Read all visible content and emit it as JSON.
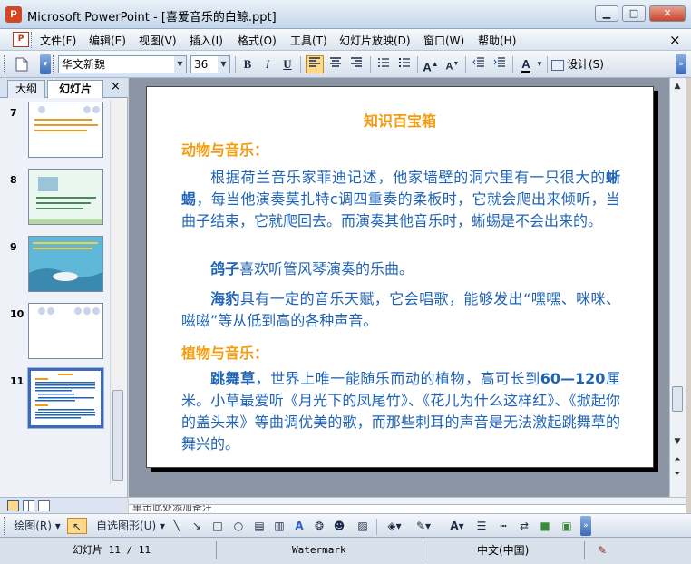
{
  "window": {
    "title": "Microsoft PowerPoint - [喜爱音乐的白鲸.ppt]",
    "app_icon_letter": "P",
    "minimize": "▁",
    "maximize": "□",
    "close": "✕"
  },
  "menu": {
    "items": [
      "文件(F)",
      "编辑(E)",
      "视图(V)",
      "插入(I)",
      "格式(O)",
      "工具(T)",
      "幻灯片放映(D)",
      "窗口(W)",
      "帮助(H)"
    ],
    "close": "×"
  },
  "toolbar": {
    "font_name": "华文新魏",
    "font_size": "36",
    "bold": "B",
    "italic": "I",
    "underline": "U",
    "design": "设计(S)",
    "more": "»"
  },
  "panel": {
    "tabs": [
      "大纲",
      "幻灯片"
    ],
    "close": "×",
    "thumbnails": [
      {
        "number": "7"
      },
      {
        "number": "8"
      },
      {
        "number": "9"
      },
      {
        "number": "10"
      },
      {
        "number": "11",
        "selected": true
      }
    ]
  },
  "slide": {
    "title": "知识百宝箱",
    "section_animals": "动物与音乐：",
    "p1_pre": "根据荷兰音乐家菲迪记述，他家墙壁的洞穴里有一只很大的",
    "p1_bold": "蜥蜴",
    "p1_post": "，每当他演奏莫扎特c调四重奏的柔板时，它就会爬出来倾听，当曲子结束，它就爬回去。而演奏其他音乐时，蜥蜴是不会出来的。",
    "p2_bold": "鸽子",
    "p2_post": "喜欢听管风琴演奏的乐曲。",
    "p3_bold": "海豹",
    "p3_post": "具有一定的音乐天赋，它会唱歌，能够发出“嘿嘿、咪咪、嗞嗞”等从低到高的各种声音。",
    "section_plants": "植物与音乐：",
    "p4_bold": "跳舞草",
    "p4_mid": "，世界上唯一能随乐而动的植物，高可长到",
    "p4_bold2": "60—120",
    "p4_post": "厘米。小草最爱听《月光下的凤尾竹》、《花儿为什么这样红》、《掀起你的盖头来》等曲调优美的歌，而那些刺耳的声音是无法激起跳舞草的舞兴的。"
  },
  "notes": {
    "placeholder": "单击此处添加备注"
  },
  "drawbar": {
    "draw": "绘图(R)",
    "autoshapes": "自选图形(U)"
  },
  "status": {
    "slide_pos": "幻灯片 11 / 11",
    "template": "Watermark",
    "language": "中文(中国)"
  },
  "colors": {
    "accent_orange": "#f39c12",
    "text_blue": "#1e63b5",
    "selection": "#3a6ab8"
  }
}
